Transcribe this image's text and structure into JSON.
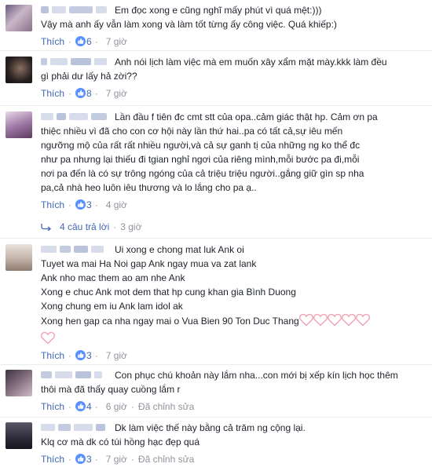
{
  "actions": {
    "like_label": "Thích",
    "dot": "·",
    "edited_label": "Đã chỉnh sửa"
  },
  "icons": {
    "like": "thumbs-up-icon",
    "reply": "reply-arrow-icon",
    "heart": "heart-icon"
  },
  "colors": {
    "link": "#4267b2",
    "meta": "#90949c",
    "text": "#1d2129",
    "heart": "#f0a3b5"
  },
  "comments": [
    {
      "text": "Em đọc xong e cũng nghĩ mấy phút vì quá mệt:)))\nVậy mà anh ấy vẫn làm xong và làm tốt từng ấy công việc. Quá khiếp:)",
      "likes": "6",
      "time": "7 giờ"
    },
    {
      "text": "Anh nói lịch làm việc mà em muốn xây xẩm mặt mày.kkk làm đều\ngì phải dư lấy hả zời??",
      "likes": "8",
      "time": "7 giờ"
    },
    {
      "text": "Lần đầu f tiên đc cmt stt của opa..cảm giác thật hp. Cảm ơn pa\nthiệc nhiều vì đã cho con cơ hội này lần thứ hai..pa có tất cả,sự iêu mến\nngưỡng mộ của rất rất nhiều người,và cả sự ganh tị của những ng ko thể đc\nnhư pa nhưng lại thiếu đi tgian nghỉ ngơi của riêng mình,mỗi bước pa đi,mỗi\nnơi pa đến là có sự trông ngóng của cả triệu triệu người..gắng giữ gìn sp nha\npa,cả nhà heo luôn iêu thương và lo lắng cho pa ạ..",
      "likes": "3",
      "time": "4 giờ",
      "replies": "4 câu trả lời",
      "replies_time": "3 giờ"
    },
    {
      "text": "Ui xong e chong mat luk Ank oi\nTuyet wa mai Ha Noi gap Ank ngay mua va zat lank\nAnk nho mac them ao am nhe Ank\nXong e chuc Ank mot dem that hp cung khan gia Bình Duong\nXong chung em iu Ank lam idol ak\nXong hen gap ca nha ngay mai o Vua Bien 90 Ton Duc Thang",
      "hearts": 6,
      "likes": "3",
      "time": "7 giờ"
    },
    {
      "text": "Con phục chú khoản này lắm nha...con mới bị xếp kín lịch học thêm\nthôi mà đã thấy quay cuồng lắm r",
      "likes": "4",
      "time": "6 giờ",
      "edited": true
    },
    {
      "text": "Dk làm việc thế này bằng cả trăm ng cộng lại.\nKlq cơ mà dk có túi hồng hạc đẹp quá",
      "likes": "3",
      "time": "7 giờ",
      "edited": true
    }
  ]
}
